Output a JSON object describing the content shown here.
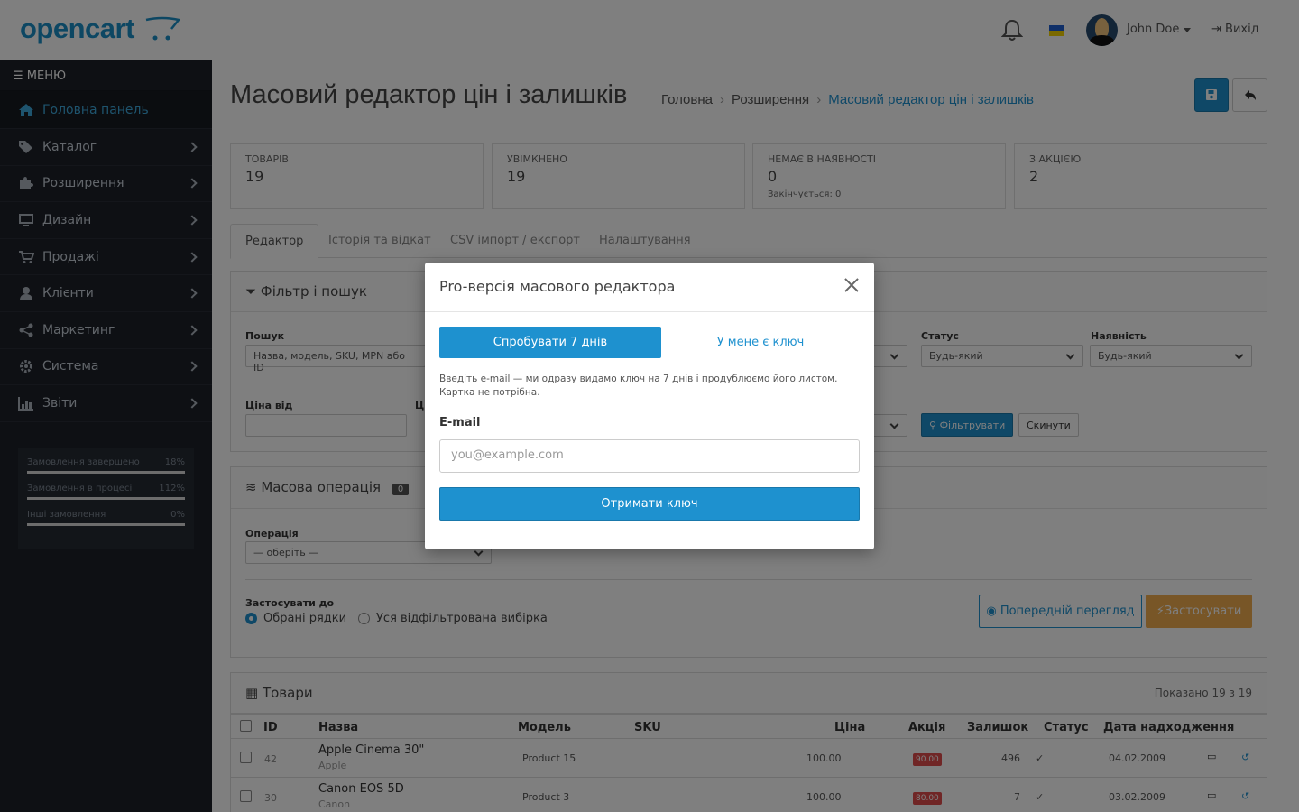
{
  "header": {
    "logo": "opencart",
    "user_name": "John Doe",
    "logout": "Вихід"
  },
  "sidebar": {
    "menu_label": "МЕНЮ",
    "items": [
      {
        "label": "Головна панель",
        "icon": "home-icon",
        "active": true
      },
      {
        "label": "Каталог",
        "icon": "tag-icon"
      },
      {
        "label": "Розширення",
        "icon": "puzzle-icon"
      },
      {
        "label": "Дизайн",
        "icon": "desktop-icon"
      },
      {
        "label": "Продажі",
        "icon": "cart-icon"
      },
      {
        "label": "Клієнти",
        "icon": "user-icon"
      },
      {
        "label": "Маркетинг",
        "icon": "share-icon"
      },
      {
        "label": "Система",
        "icon": "gear-icon"
      },
      {
        "label": "Звіти",
        "icon": "bar-chart-icon"
      }
    ],
    "stats": [
      {
        "label": "Замовлення завершено",
        "value": "18%",
        "fill": 1.0
      },
      {
        "label": "Замовлення в процесі",
        "value": "112%",
        "fill": 1.0
      },
      {
        "label": "Інші замовлення",
        "value": "0%",
        "fill": 1.0
      }
    ]
  },
  "page": {
    "title": "Масовий редактор цін і залишків",
    "breadcrumb": [
      "Головна",
      "Розширення",
      "Масовий редактор цін і залишків"
    ]
  },
  "kpis": [
    {
      "label": "ТОВАРІВ",
      "value": "19",
      "sub": ""
    },
    {
      "label": "УВІМКНЕНО",
      "value": "19",
      "sub": ""
    },
    {
      "label": "НЕМАЄ В НАЯВНОСТІ",
      "value": "0",
      "sub": "Закінчується: 0"
    },
    {
      "label": "З АКЦІЄЮ",
      "value": "2",
      "sub": ""
    }
  ],
  "tabs": [
    "Редактор",
    "Історія та відкат",
    "CSV імпорт / експорт",
    "Налаштування"
  ],
  "filter": {
    "title": "Фільтр і пошук",
    "search_label": "Пошук",
    "search_placeholder": "Назва, модель, SKU, MPN або ID",
    "status_label": "Статус",
    "status_value": "Будь-який",
    "stock_label": "Наявність",
    "stock_value": "Будь-який",
    "price_from_label": "Ціна від",
    "price_to_label_partial": "Ц",
    "filter_button": "Фільтрувати",
    "reset_button": "Скинути"
  },
  "bulk": {
    "title": "Масова операція",
    "count_badge": "0",
    "operation_label": "Операція",
    "operation_value": "— оберіть —",
    "apply_to_label": "Застосувати до",
    "radio_selected": "Обрані рядки",
    "radio_all": "Уся відфільтрована вибірка",
    "preview_button": "Попередній перегляд",
    "apply_button": "Застосувати"
  },
  "products": {
    "title": "Товари",
    "shown": "Показано 19 з 19",
    "columns": [
      "ID",
      "Назва",
      "Модель",
      "SKU",
      "Ціна",
      "Акція",
      "Залишок",
      "Статус",
      "Дата надходження"
    ],
    "rows": [
      {
        "id": "42",
        "name": "Apple Cinema 30\"",
        "brand": "Apple",
        "model": "Product 15",
        "sku": "",
        "price": "100.00",
        "special": "90.00",
        "stock": "496",
        "status": "✓",
        "date": "04.02.2009"
      },
      {
        "id": "30",
        "name": "Canon EOS 5D",
        "brand": "Canon",
        "model": "Product 3",
        "sku": "",
        "price": "100.00",
        "special": "80.00",
        "stock": "7",
        "status": "✓",
        "date": "03.02.2009"
      }
    ]
  },
  "modal": {
    "title": "Pro-версія масового редактора",
    "try_button": "Спробувати 7 днів",
    "have_key_link": "У мене є ключ",
    "note": "Введіть e-mail — ми одразу видамо ключ на 7 днів і продублюємо його листом. Картка не потрібна.",
    "email_label": "E-mail",
    "email_placeholder": "you@example.com",
    "submit_button": "Отримати ключ"
  },
  "colors": {
    "brand": "#1e91cf",
    "sidebar_bg": "#1d2129",
    "danger": "#e04c4c",
    "warning": "#f0ad4e"
  }
}
